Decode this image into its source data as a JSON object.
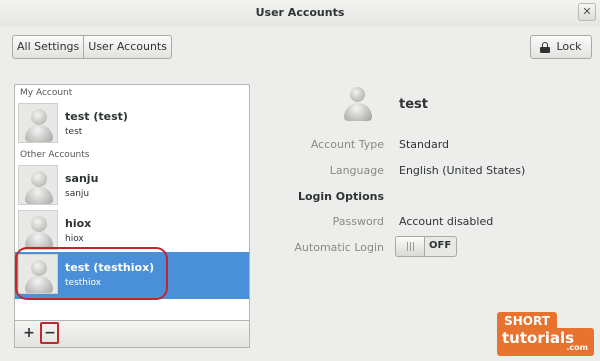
{
  "window": {
    "title": "User Accounts",
    "close_glyph": "✕"
  },
  "header": {
    "nav": [
      "All Settings",
      "User Accounts"
    ],
    "lock_label": "Lock",
    "lock_icon": "lock-icon"
  },
  "accounts": {
    "my_account_label": "My Account",
    "other_accounts_label": "Other Accounts",
    "my_account": {
      "name": "test (test)",
      "login": "test"
    },
    "others": [
      {
        "name": "sanju",
        "login": "sanju"
      },
      {
        "name": "hiox",
        "login": "hiox"
      },
      {
        "name": "test (testhiox)",
        "login": "testhiox",
        "selected": true
      }
    ],
    "toolbar": {
      "add": "+",
      "remove": "−"
    }
  },
  "details": {
    "name": "test",
    "account_type_label": "Account Type",
    "account_type": "Standard",
    "language_label": "Language",
    "language": "English (United States)",
    "login_options_heading": "Login Options",
    "password_label": "Password",
    "password": "Account disabled",
    "automatic_login_label": "Automatic Login",
    "automatic_login_state": "OFF"
  },
  "watermark": {
    "line1": "SHORT",
    "line2": "tutorials",
    "suffix": ".com"
  },
  "colors": {
    "selection": "#4a90d9",
    "highlight_ring": "#c0262d",
    "watermark": "#e8732e"
  }
}
